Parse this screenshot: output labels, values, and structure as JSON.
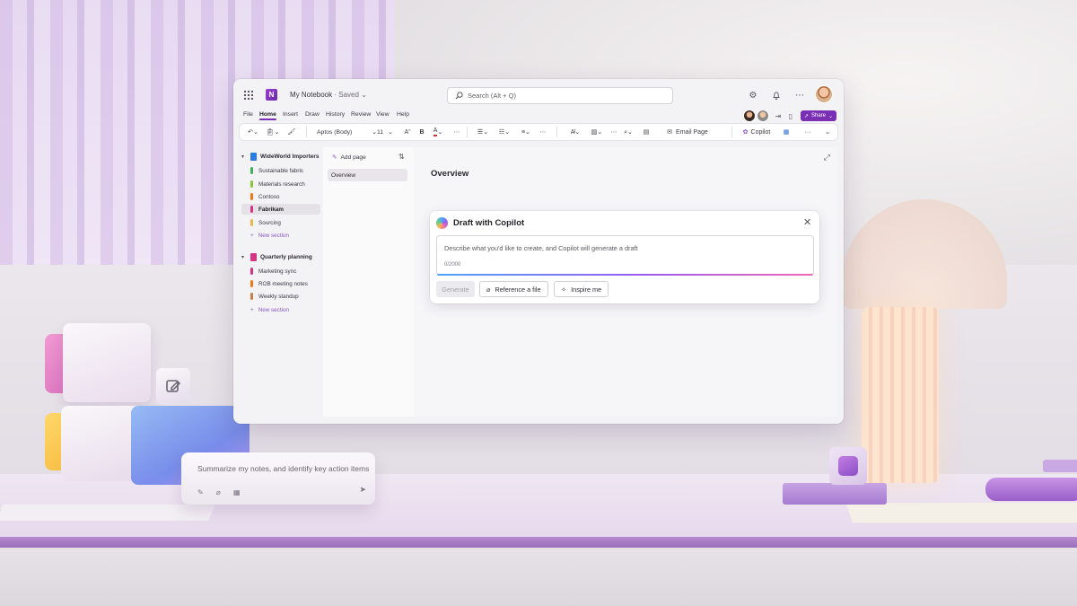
{
  "titlebar": {
    "notebook_title": "My Notebook",
    "saved_status": "· Saved",
    "search_placeholder": "Search (Alt + Q)"
  },
  "menu": {
    "tabs": [
      "File",
      "Home",
      "Insert",
      "Draw",
      "History",
      "Review",
      "View",
      "Help"
    ],
    "active_tab": "Home",
    "share_label": "Share"
  },
  "ribbon": {
    "font_name": "Aptos (Body)",
    "font_size": "11",
    "bold_label": "B",
    "grow_font_label": "A",
    "font_color_label": "A",
    "email_page_label": "Email Page",
    "copilot_label": "Copilot",
    "more_label": "···"
  },
  "notebooks": [
    {
      "name": "WideWorld Importers",
      "color": "#2b7de0",
      "sections": [
        {
          "label": "Sustainable fabric",
          "color": "#3fb35a"
        },
        {
          "label": "Materials research",
          "color": "#8ac53e"
        },
        {
          "label": "Contoso",
          "color": "#f07a1a"
        },
        {
          "label": "Fabrikam",
          "color": "#d63384",
          "active": true
        },
        {
          "label": "Sourcing",
          "color": "#e9b84a"
        }
      ],
      "new_section_label": "New section"
    },
    {
      "name": "Quarterly planning",
      "color": "#d63384",
      "sections": [
        {
          "label": "Marketing sync",
          "color": "#d63384"
        },
        {
          "label": "ROB meeting notes",
          "color": "#f07a1a"
        },
        {
          "label": "Weekly standup",
          "color": "#c87f4a"
        }
      ],
      "new_section_label": "New section"
    }
  ],
  "pages": {
    "add_page_label": "Add page",
    "items": [
      "Overview"
    ]
  },
  "canvas": {
    "page_title": "Overview"
  },
  "copilot": {
    "title": "Draft with Copilot",
    "placeholder": "Describe what you'd like to create, and Copilot will generate a draft",
    "char_count": "0/2000",
    "generate_label": "Generate",
    "reference_label": "Reference a file",
    "inspire_label": "Inspire me"
  },
  "desk_prompt": {
    "text": "Summarize my notes, and identify key action items"
  },
  "colors": {
    "accent": "#7a2fb5"
  }
}
